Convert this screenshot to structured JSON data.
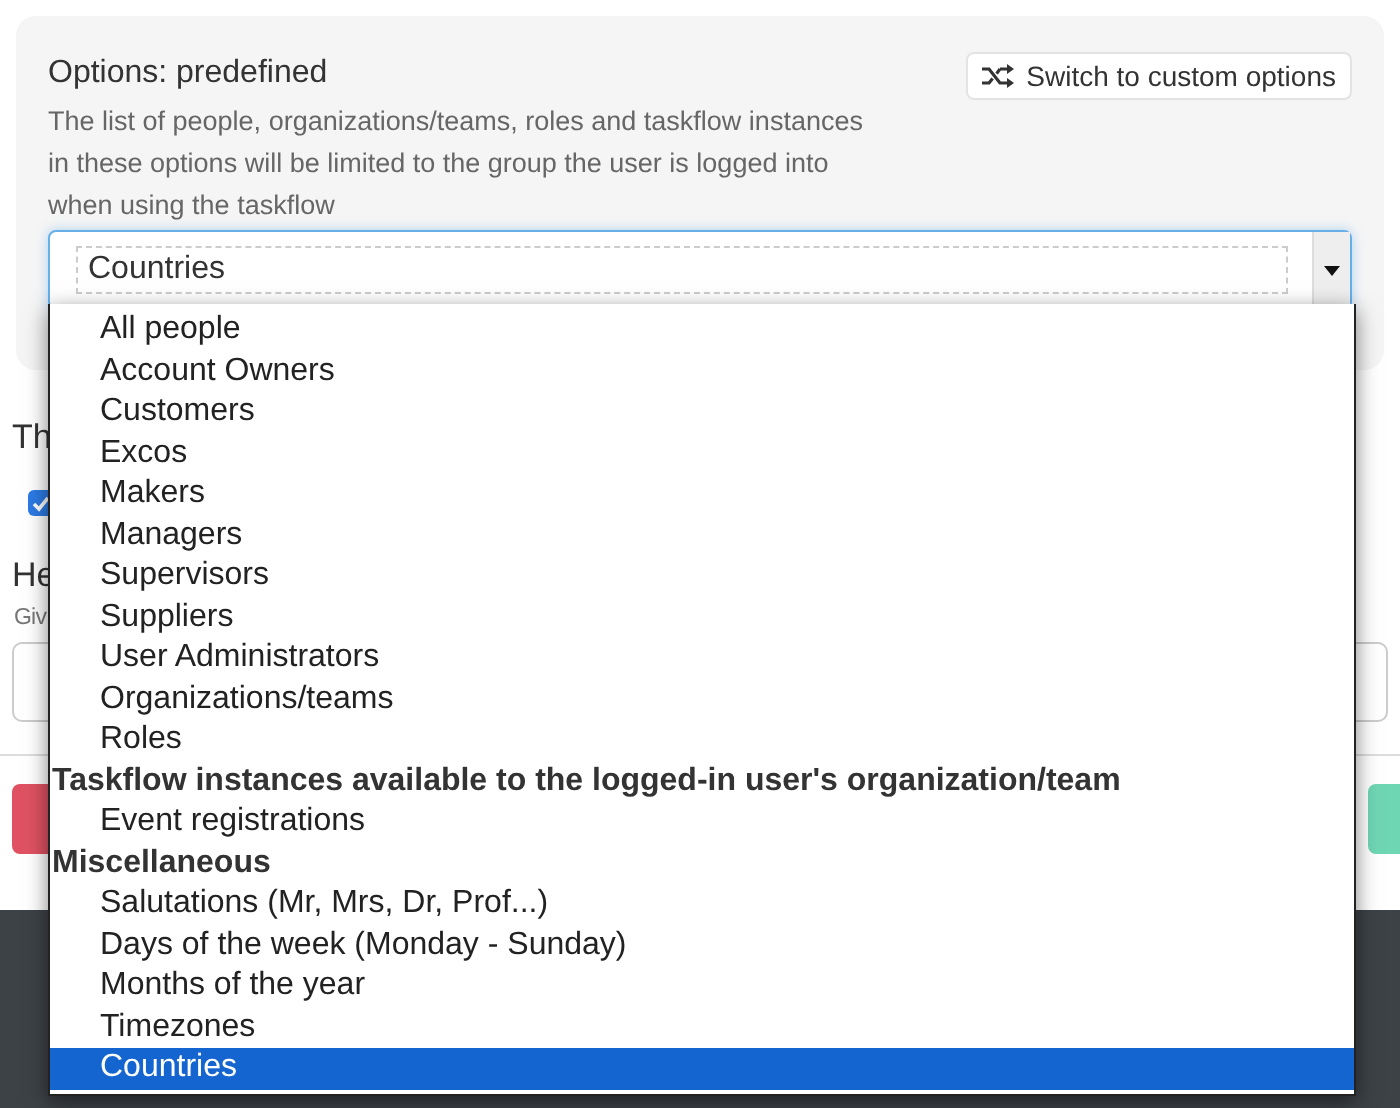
{
  "panel": {
    "title": "Options: predefined",
    "switch_button": "Switch to custom options",
    "description": "The list of people, organizations/teams, roles and taskflow instances in these options will be limited to the group the user is logged into when using the taskflow",
    "select": {
      "value": "Countries",
      "expanded": true
    }
  },
  "behind": {
    "heading": "Th",
    "checkbox": {
      "checked": true
    },
    "field_heading": "He",
    "field_hint": "Giv"
  },
  "dropdown": {
    "options": [
      {
        "kind": "option",
        "label": "All people",
        "selected": false
      },
      {
        "kind": "option",
        "label": "Account Owners",
        "selected": false
      },
      {
        "kind": "option",
        "label": "Customers",
        "selected": false
      },
      {
        "kind": "option",
        "label": "Excos",
        "selected": false
      },
      {
        "kind": "option",
        "label": "Makers",
        "selected": false
      },
      {
        "kind": "option",
        "label": "Managers",
        "selected": false
      },
      {
        "kind": "option",
        "label": "Supervisors",
        "selected": false
      },
      {
        "kind": "option",
        "label": "Suppliers",
        "selected": false
      },
      {
        "kind": "option",
        "label": "User Administrators",
        "selected": false
      },
      {
        "kind": "option",
        "label": "Organizations/teams",
        "selected": false
      },
      {
        "kind": "option",
        "label": "Roles",
        "selected": false
      },
      {
        "kind": "group",
        "label": "Taskflow instances available to the logged-in user's organization/team"
      },
      {
        "kind": "option",
        "label": "Event registrations",
        "selected": false
      },
      {
        "kind": "group",
        "label": "Miscellaneous"
      },
      {
        "kind": "option",
        "label": "Salutations (Mr, Mrs, Dr, Prof...)",
        "selected": false
      },
      {
        "kind": "option",
        "label": "Days of the week (Monday - Sunday)",
        "selected": false
      },
      {
        "kind": "option",
        "label": "Months of the year",
        "selected": false
      },
      {
        "kind": "option",
        "label": "Timezones",
        "selected": false
      },
      {
        "kind": "option",
        "label": "Countries",
        "selected": true
      }
    ]
  }
}
